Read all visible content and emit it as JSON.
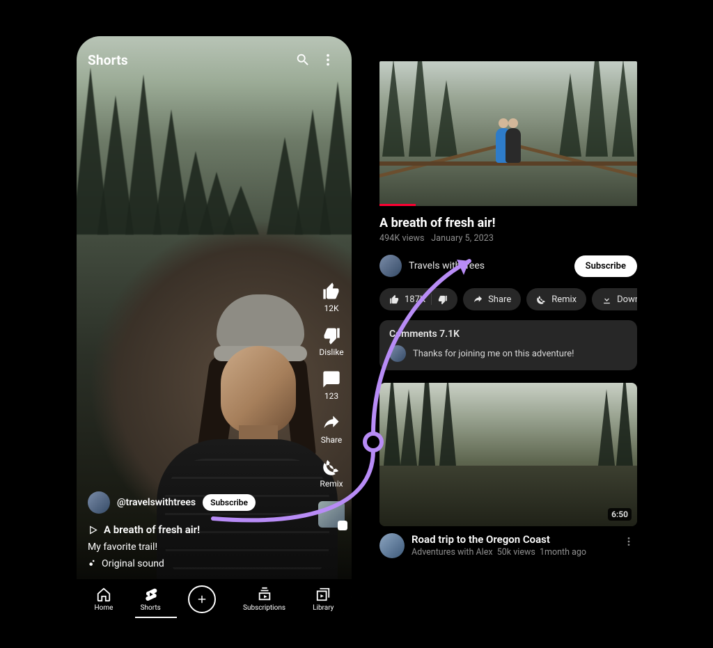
{
  "shorts": {
    "header": "Shorts",
    "rail": {
      "like_count": "12K",
      "dislike": "Dislike",
      "comment_count": "123",
      "share": "Share",
      "remix": "Remix"
    },
    "user": {
      "handle": "@travelswithtrees",
      "subscribe": "Subscribe"
    },
    "title": "A breath of fresh air!",
    "caption": "My favorite trail!",
    "sound": "Original sound",
    "nav": {
      "home": "Home",
      "shorts": "Shorts",
      "subs": "Subscriptions",
      "library": "Library"
    }
  },
  "watch": {
    "title": "A breath of fresh air!",
    "views": "494K views",
    "date": "January 5, 2023",
    "channel": "Travels with trees",
    "subscribe": "Subscribe",
    "chips": {
      "likes": "187K",
      "share": "Share",
      "remix": "Remix",
      "download": "Down"
    },
    "comments": {
      "heading": "Comments 7.1K",
      "top": "Thanks for joining me on this adventure!"
    },
    "rec": {
      "duration": "6:50",
      "title": "Road trip to the Oregon Coast",
      "channel": "Adventures with Alex",
      "views": "50k views",
      "age": "1month ago"
    }
  }
}
